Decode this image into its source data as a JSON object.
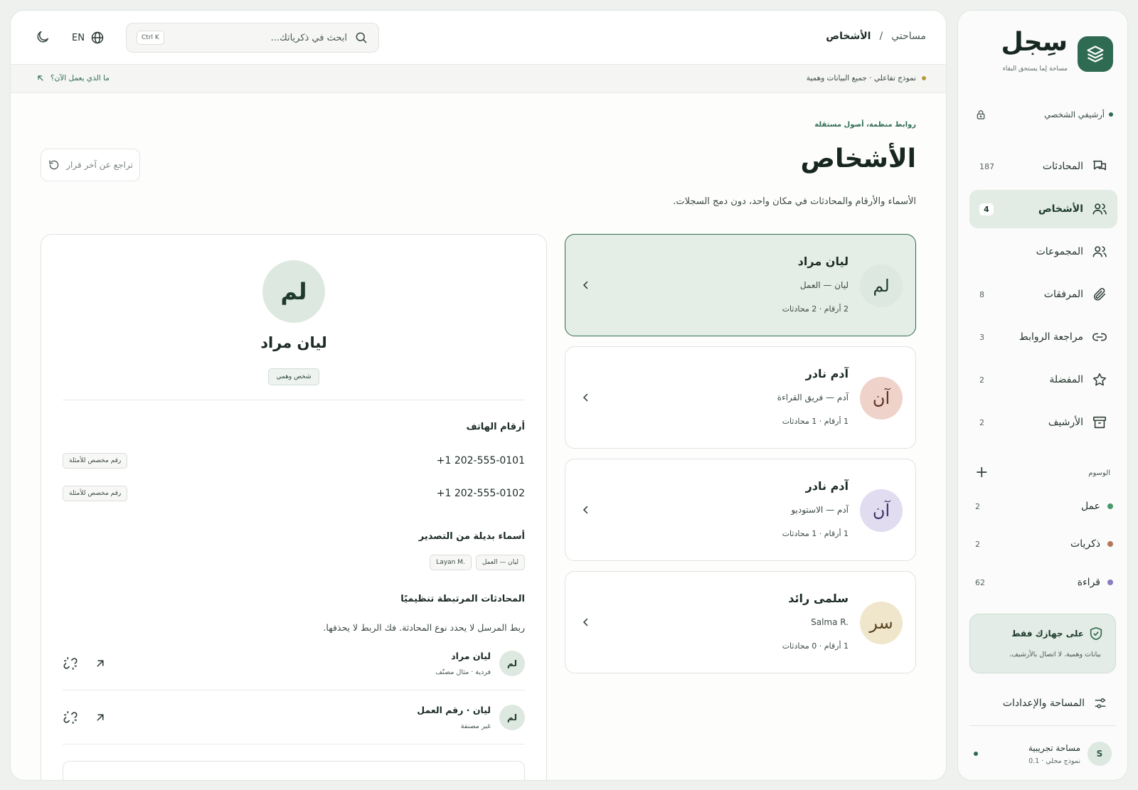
{
  "brand": {
    "name": "سِجل",
    "tagline": "مساحة لِما يستحق البقاء"
  },
  "sidebar": {
    "archive_label": "أرشيفي الشخصي",
    "items": [
      {
        "label": "المحادثات",
        "count": "187",
        "icon": "chat-icon"
      },
      {
        "label": "الأشخاص",
        "count": "4",
        "icon": "people-icon",
        "active": true
      },
      {
        "label": "المجموعات",
        "count": "",
        "icon": "group-icon"
      },
      {
        "label": "المرفقات",
        "count": "8",
        "icon": "paperclip-icon"
      },
      {
        "label": "مراجعة الروابط",
        "count": "3",
        "icon": "link-icon"
      },
      {
        "label": "المفضلة",
        "count": "2",
        "icon": "star-icon"
      },
      {
        "label": "الأرشيف",
        "count": "2",
        "icon": "archive-icon"
      }
    ],
    "tags_title": "الوسوم",
    "tags": [
      {
        "label": "عمل",
        "count": "2",
        "color": "#4a9b6b"
      },
      {
        "label": "ذكريات",
        "count": "2",
        "color": "#b07a5a"
      },
      {
        "label": "قراءة",
        "count": "62",
        "color": "#8a7cc0"
      }
    ],
    "local_card": {
      "title": "على جهازك فقط",
      "subtitle": "بيانات وهمية. لا اتصال بالأرشيف."
    },
    "settings_label": "المساحة والإعدادات",
    "workspace": {
      "avatar": "S",
      "name": "مساحة تجريبية",
      "sub": "نموذج محلي · 0.1"
    }
  },
  "topbar": {
    "breadcrumb_root": "مساحتي",
    "breadcrumb_sep": "/",
    "breadcrumb_current": "الأشخاص",
    "search_placeholder": "ابحث في ذكرياتك...",
    "search_shortcut": "Ctrl K",
    "lang": "EN"
  },
  "notice": {
    "text": "نموذج تفاعلي · جميع البيانات وهمية",
    "link": "ما الذي يعمل الآن؟"
  },
  "page": {
    "eyebrow": "روابط منظمة، أصول مستقلة",
    "title": "الأشخاص",
    "subtitle": "الأسماء والأرقام والمحادثات في مكان واحد، دون دمج السجلات.",
    "undo_label": "تراجع عن آخر قرار"
  },
  "people": [
    {
      "initials": "لم",
      "name": "ليان مراد",
      "alias": "ليان — العمل",
      "meta": "2 أرقام · 2 محادثات",
      "avatar_bg": "#dde8e0",
      "avatar_fg": "#1e3a2d",
      "selected": true
    },
    {
      "initials": "آن",
      "name": "آدم نادر",
      "alias": "آدم — فريق القراءة",
      "meta": "1 أرقام · 1 محادثات",
      "avatar_bg": "#efd3cb",
      "avatar_fg": "#5a2e24"
    },
    {
      "initials": "آن",
      "name": "آدم نادر",
      "alias": "آدم — الاستوديو",
      "meta": "1 أرقام · 1 محادثات",
      "avatar_bg": "#e2dcf0",
      "avatar_fg": "#3c3466"
    },
    {
      "initials": "سر",
      "name": "سلمى رائد",
      "alias": "Salma R.",
      "meta": "1 أرقام · 0 محادثات",
      "avatar_bg": "#f0e6cc",
      "avatar_fg": "#5a4620"
    }
  ],
  "detail": {
    "initials": "لم",
    "name": "ليان مراد",
    "badge": "شخص وهمي",
    "phones_title": "أرقام الهاتف",
    "phones": [
      {
        "number": "+1 202-555-0101",
        "chip": "رقم مخصص للأمثلة"
      },
      {
        "number": "+1 202-555-0102",
        "chip": "رقم مخصص للأمثلة"
      }
    ],
    "alt_names_title": "أسماء بديلة من التصدير",
    "alt_names": [
      "ليان — العمل",
      "Layan M."
    ],
    "linked_title": "المحادثات المرتبطة تنظيميًا",
    "linked_desc": "ربط المرسل لا يحدد نوع المحادثة. فك الربط لا يحذفها.",
    "conversations": [
      {
        "initials": "لم",
        "title": "ليان مراد",
        "sub": "فردية · مثال مصنّف"
      },
      {
        "initials": "لم",
        "title": "ليان · رقم العمل",
        "sub": "غير مصنفة"
      }
    ]
  },
  "colors": {
    "accent": "#2f6b52",
    "selected_bg": "#e4ede6",
    "archive_dot": "#2f6b52",
    "notice_dot": "#b59a3a"
  }
}
